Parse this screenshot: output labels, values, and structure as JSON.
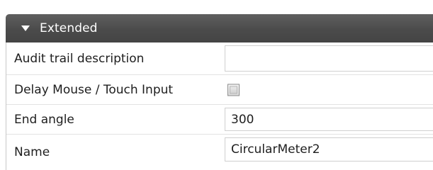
{
  "section": {
    "title": "Extended",
    "expanded": true,
    "header_color": "#4b4b4b"
  },
  "properties": [
    {
      "label": "Audit trail description",
      "type": "text",
      "value": ""
    },
    {
      "label": "Delay Mouse / Touch Input",
      "type": "checkbox",
      "checked": false
    },
    {
      "label": "End angle",
      "type": "text",
      "value": "300"
    },
    {
      "label": "Name",
      "type": "text",
      "value": "CircularMeter2"
    }
  ]
}
